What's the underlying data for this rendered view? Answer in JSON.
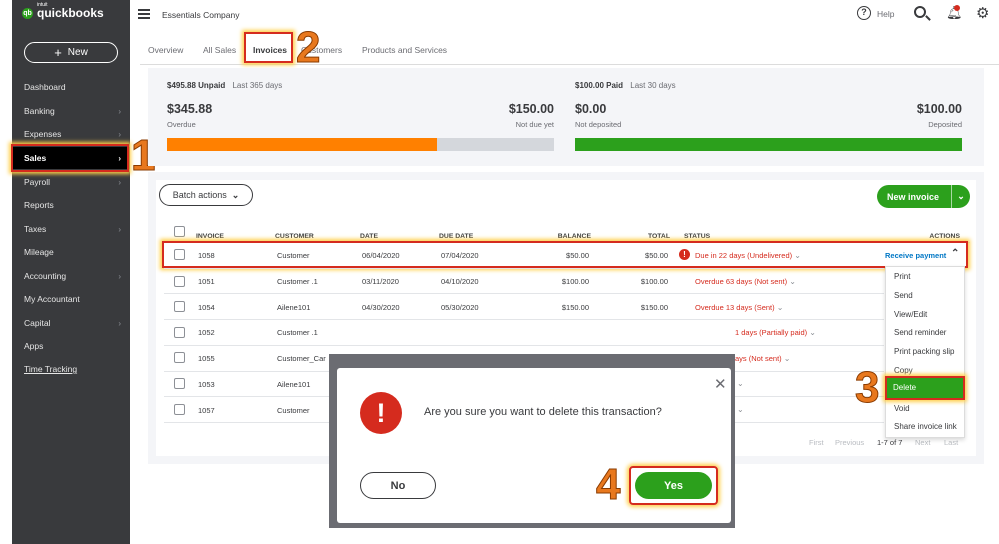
{
  "app": {
    "logo_text": "quickbooks",
    "logo_sub": "intuit",
    "company": "Essentials Company"
  },
  "sidebar": {
    "new_label": "New",
    "items": [
      {
        "label": "Dashboard",
        "chevron": false
      },
      {
        "label": "Banking",
        "chevron": true
      },
      {
        "label": "Expenses",
        "chevron": true
      },
      {
        "label": "Sales",
        "chevron": true,
        "active": true
      },
      {
        "label": "Payroll",
        "chevron": true
      },
      {
        "label": "Reports",
        "chevron": false
      },
      {
        "label": "Taxes",
        "chevron": true
      },
      {
        "label": "Mileage",
        "chevron": false
      },
      {
        "label": "Accounting",
        "chevron": true
      },
      {
        "label": "My Accountant",
        "chevron": false
      },
      {
        "label": "Capital",
        "chevron": true
      },
      {
        "label": "Apps",
        "chevron": false
      },
      {
        "label": "Time Tracking",
        "chevron": false,
        "underline": true
      }
    ]
  },
  "header": {
    "help_label": "Help"
  },
  "tabs": [
    "Overview",
    "All Sales",
    "Invoices",
    "Customers",
    "Products and Services"
  ],
  "steps": [
    "1",
    "2",
    "3",
    "4"
  ],
  "summary": {
    "unpaid_head": "$495.88 Unpaid",
    "unpaid_period": "Last 365 days",
    "overdue_amt": "$345.88",
    "overdue_label": "Overdue",
    "notdue_amt": "$150.00",
    "notdue_label": "Not due yet",
    "overdue_fraction": 0.697,
    "paid_head": "$100.00 Paid",
    "paid_period": "Last 30 days",
    "notdeposited_amt": "$0.00",
    "notdeposited_label": "Not deposited",
    "deposited_amt": "$100.00",
    "deposited_label": "Deposited",
    "deposited_fraction": 1.0,
    "colors": {
      "overdue": "#ff8000",
      "notdue": "#d4d7dc",
      "deposited": "#2ca01c"
    }
  },
  "table": {
    "batch_label": "Batch actions",
    "new_invoice_label": "New invoice",
    "headers": {
      "invoice": "INVOICE",
      "customer": "CUSTOMER",
      "date": "DATE",
      "due": "DUE DATE",
      "balance": "BALANCE",
      "total": "TOTAL",
      "status": "STATUS",
      "actions": "ACTIONS"
    },
    "rows": [
      {
        "invoice": "1058",
        "customer": "Customer",
        "date": "06/04/2020",
        "due": "07/04/2020",
        "balance": "$50.00",
        "total": "$50.00",
        "status": "Due in 22 days (Undelivered)"
      },
      {
        "invoice": "1051",
        "customer": "Customer .1",
        "date": "03/11/2020",
        "due": "04/10/2020",
        "balance": "$100.00",
        "total": "$100.00",
        "status": "Overdue 63 days (Not sent)"
      },
      {
        "invoice": "1054",
        "customer": "Ailene101",
        "date": "04/30/2020",
        "due": "05/30/2020",
        "balance": "$150.00",
        "total": "$150.00",
        "status": "Overdue 13 days (Sent)"
      },
      {
        "invoice": "1052",
        "customer": "Customer .1",
        "date": "",
        "due": "",
        "balance": "",
        "total": "",
        "status": "1 days (Partially paid)"
      },
      {
        "invoice": "1055",
        "customer": "Customer_Car",
        "date": "",
        "due": "",
        "balance": "",
        "total": "",
        "status": "ays (Not sent)"
      },
      {
        "invoice": "1053",
        "customer": "Ailene101",
        "date": "",
        "due": "",
        "balance": "",
        "total": "",
        "status": ""
      },
      {
        "invoice": "1057",
        "customer": "Customer",
        "date": "",
        "due": "",
        "balance": "",
        "total": "",
        "status": ""
      }
    ],
    "receive_payment": "Receive payment"
  },
  "action_menu": [
    "Print",
    "Send",
    "View/Edit",
    "Send reminder",
    "Print packing slip",
    "Copy",
    "Delete",
    "Void",
    "Share invoice link"
  ],
  "pagination": {
    "first": "First",
    "previous": "Previous",
    "range": "1-7 of 7",
    "next": "Next",
    "last": "Last"
  },
  "modal": {
    "message": "Are you sure you want to delete this transaction?",
    "no_label": "No",
    "yes_label": "Yes",
    "icon_glyph": "!"
  }
}
